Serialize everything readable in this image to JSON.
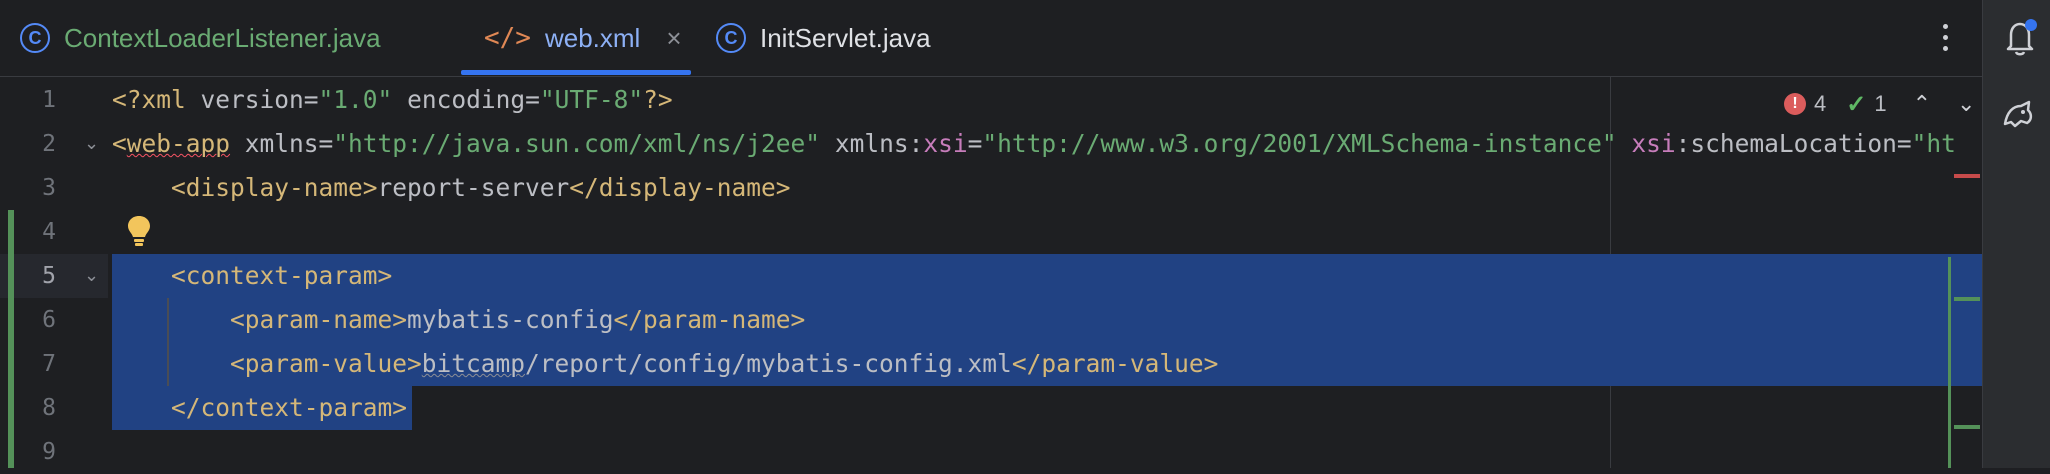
{
  "tabs": [
    {
      "label": "ContextLoaderListener.java",
      "icon": "class-icon",
      "active": false
    },
    {
      "label": "web.xml",
      "icon": "xml-icon",
      "active": true,
      "close": "×"
    },
    {
      "label": "InitServlet.java",
      "icon": "class-icon",
      "active": false
    }
  ],
  "icons": {
    "class": "C",
    "xml": "</>"
  },
  "inspections": {
    "errors": "4",
    "ok": "1"
  },
  "lines": [
    {
      "num": "1"
    },
    {
      "num": "2"
    },
    {
      "num": "3"
    },
    {
      "num": "4"
    },
    {
      "num": "5"
    },
    {
      "num": "6"
    },
    {
      "num": "7"
    },
    {
      "num": "8"
    },
    {
      "num": "9"
    }
  ],
  "code": {
    "l1": {
      "decl_open": "<?xml ",
      "v_attr": "version=",
      "v_val": "\"1.0\"",
      "sp": " ",
      "e_attr": "encoding=",
      "e_val": "\"UTF-8\"",
      "decl_close": "?>"
    },
    "l2": {
      "lt": "<",
      "tag": "web-app",
      "a1": " xmlns=",
      "v1": "\"http://java.sun.com/xml/ns/j2ee\"",
      "a2": " xmlns:",
      "ns2": "xsi",
      "eq2": "=",
      "v2": "\"http://www.w3.org/2001/XMLSchema-instance\"",
      "sp3": " ",
      "ns3": "xsi",
      "a3": ":schemaLocation=",
      "v3": "\"ht"
    },
    "l3": {
      "indent": "    ",
      "open": "<display-name>",
      "text": "report-server",
      "close": "</display-name>"
    },
    "l5": {
      "indent": "    ",
      "tag": "<context-param>"
    },
    "l6": {
      "indent": "        ",
      "open": "<param-name>",
      "text": "mybatis-config",
      "close": "</param-name>"
    },
    "l7": {
      "indent": "        ",
      "open": "<param-value>",
      "text1": "bitcamp",
      "text2": "/report/config/mybatis-config.xml",
      "close": "</param-value>"
    },
    "l8": {
      "indent": "    ",
      "tag": "</context-param>"
    }
  },
  "colors": {
    "background": "#1e1f22",
    "selection": "#214283",
    "tag": "#d5b778",
    "string": "#6aab73",
    "namespace": "#c77dbb",
    "accent": "#3574f0"
  }
}
